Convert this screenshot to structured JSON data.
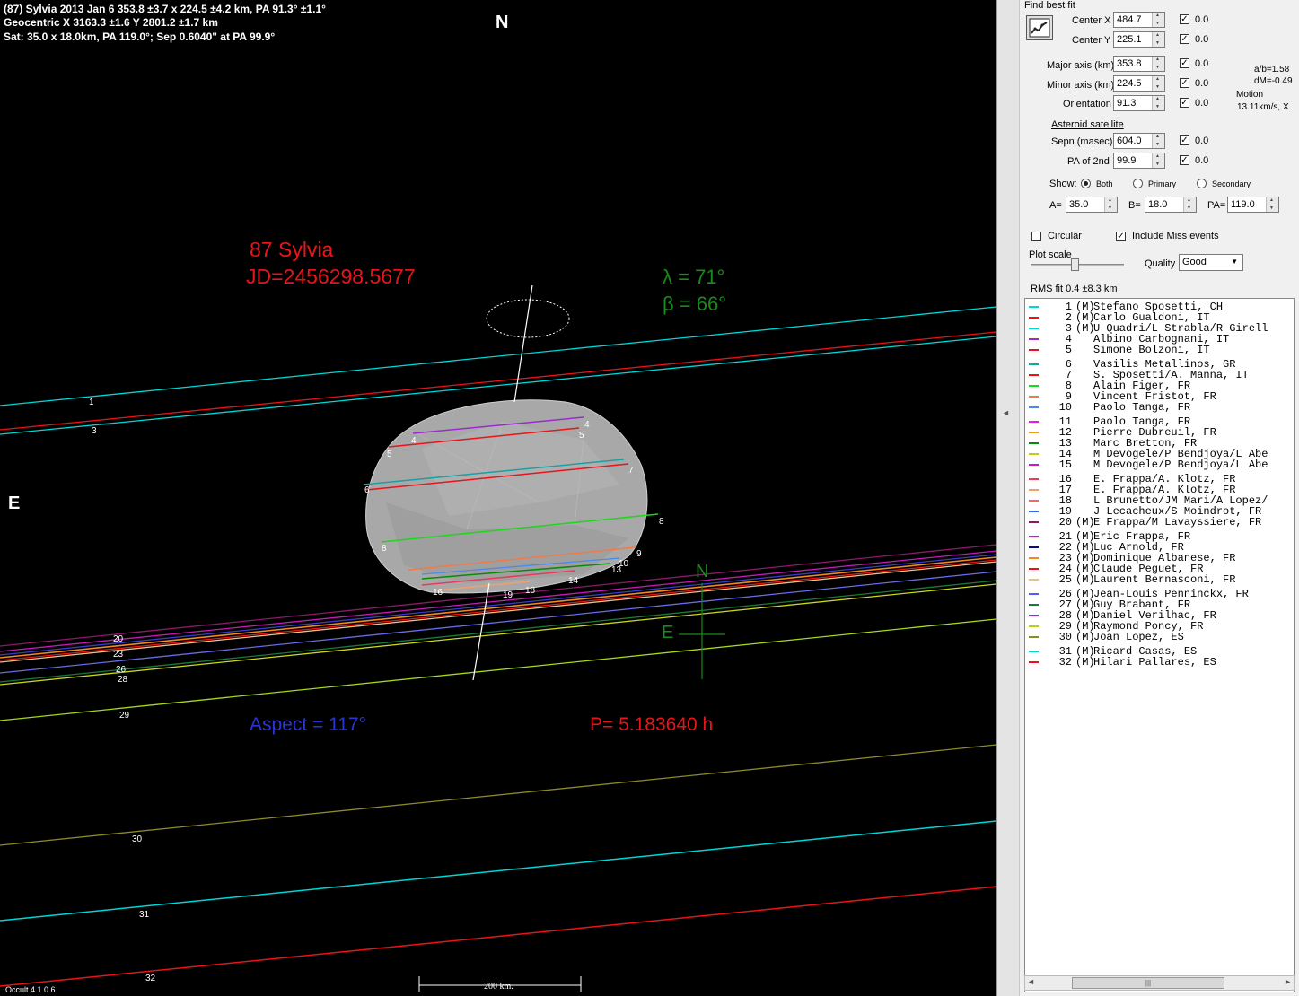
{
  "header": {
    "line1": "(87) Sylvia  2013 Jan 6   353.8 ±3.7 x 224.5 ±4.2 km, PA 91.3° ±1.1°",
    "line2": "Geocentric  X  3163.3 ±1.6  Y 2801.2 ±1.7 km",
    "line3": "Sat: 35.0 x 18.0km, PA 119.0°; Sep 0.6040\" at PA 99.9°"
  },
  "plot": {
    "north": "N",
    "east": "E",
    "asteroid_name": "87 Sylvia",
    "jd": "JD=2456298.5677",
    "lambda": "λ =   71°",
    "beta": "β =   66°",
    "aspect": "Aspect = 117°",
    "period": "P= 5.183640 h",
    "scale_label": "200 km.",
    "version": "Occult 4.1.0.6",
    "compass_n": "N",
    "compass_e": "E"
  },
  "colors": {
    "background": "#000000",
    "asteroid": "#a8a8a8",
    "title_red": "#e8141a",
    "green": "#1a8a1a",
    "aspect_blue": "#2a35d8"
  },
  "panel": {
    "find_best_fit": "Find best fit",
    "fit_icon": "fit-chart-icon",
    "center_x_label": "Center X",
    "center_x": "484.7",
    "center_x_sd": "0.0",
    "center_y_label": "Center Y",
    "center_y": "225.1",
    "center_y_sd": "0.0",
    "major_label": "Major axis (km)",
    "major": "353.8",
    "major_sd": "0.0",
    "minor_label": "Minor axis (km)",
    "minor": "224.5",
    "minor_sd": "0.0",
    "orient_label": "Orientation",
    "orient": "91.3",
    "orient_sd": "0.0",
    "ab_ratio": "a/b=1.58",
    "dm": "dM=-0.49",
    "motion_label": "Motion",
    "motion_value": "13.11km/s, X",
    "sat_heading": "Asteroid satellite",
    "sepn_label": "Sepn (masec)",
    "sepn": "604.0",
    "sepn_sd": "0.0",
    "pa2_label": "PA of 2nd",
    "pa2": "99.9",
    "pa2_sd": "0.0",
    "show_label": "Show:",
    "show_both": "Both",
    "show_primary": "Primary",
    "show_secondary": "Secondary",
    "a_label": "A=",
    "a_val": "35.0",
    "b_label": "B=",
    "b_val": "18.0",
    "pa_label": "PA=",
    "pa_val": "119.0",
    "circular": "Circular",
    "include_miss": "Include Miss events",
    "plot_scale": "Plot scale",
    "quality_label": "Quality",
    "quality_value": "Good",
    "rms": "RMS fit 0.4 ±8.3 km",
    "scroll_left": "◄",
    "scroll_right": "►",
    "scroll_thumb": "|||",
    "collapse_arrow": "◄"
  },
  "observers": [
    {
      "num": "1",
      "m": "(M)",
      "name": "Stefano Sposetti, CH",
      "color": "#00d6d6"
    },
    {
      "num": "2",
      "m": "(M)",
      "name": "Carlo Gualdoni, IT",
      "color": "#e8141a"
    },
    {
      "num": "3",
      "m": "(M)",
      "name": "U Quadri/L Strabla/R Girell",
      "color": "#00d6d6"
    },
    {
      "num": "4",
      "m": "",
      "name": "Albino Carbognani, IT",
      "color": "#9a2ad0"
    },
    {
      "num": "5",
      "m": "",
      "name": "Simone Bolzoni, IT",
      "color": "#e8141a"
    },
    {
      "num": "6",
      "m": "",
      "name": "Vasilis Metallinos, GR",
      "color": "#1aa0a0"
    },
    {
      "num": "7",
      "m": "",
      "name": "S. Sposetti/A. Manna, IT",
      "color": "#e8141a"
    },
    {
      "num": "8",
      "m": "",
      "name": "Alain Figer, FR",
      "color": "#1ad81a"
    },
    {
      "num": "9",
      "m": "",
      "name": "Vincent Fristot, FR",
      "color": "#f07a4a"
    },
    {
      "num": "10",
      "m": "",
      "name": "Paolo Tanga, FR",
      "color": "#4a8ae8"
    },
    {
      "num": "11",
      "m": "",
      "name": "Paolo Tanga, FR",
      "color": "#e81ad8"
    },
    {
      "num": "12",
      "m": "",
      "name": "Pierre Dubreuil, FR",
      "color": "#e8a01a"
    },
    {
      "num": "13",
      "m": "",
      "name": "Marc Bretton, FR",
      "color": "#0a8a0a"
    },
    {
      "num": "14",
      "m": "",
      "name": "M Devogele/P Bendjoya/L Abe",
      "color": "#c8c81a"
    },
    {
      "num": "15",
      "m": "",
      "name": "M Devogele/P Bendjoya/L Abe",
      "color": "#c81ab8"
    },
    {
      "num": "16",
      "m": "",
      "name": "E. Frappa/A. Klotz, FR",
      "color": "#e83a5a"
    },
    {
      "num": "17",
      "m": "",
      "name": "E. Frappa/A. Klotz, FR",
      "color": "#f0a070"
    },
    {
      "num": "18",
      "m": "",
      "name": "L Brunetto/JM Mari/A Lopez/",
      "color": "#e86a6a"
    },
    {
      "num": "19",
      "m": "",
      "name": "J Lecacheux/S Moindrot, FR",
      "color": "#2a6ae8"
    },
    {
      "num": "20",
      "m": "(M)",
      "name": "E Frappa/M Lavayssiere, FR",
      "color": "#8a1a6a"
    },
    {
      "num": "21",
      "m": "(M)",
      "name": "Eric Frappa, FR",
      "color": "#c81ab8"
    },
    {
      "num": "22",
      "m": "(M)",
      "name": "Luc Arnold, FR",
      "color": "#0a0a8a"
    },
    {
      "num": "23",
      "m": "(M)",
      "name": "Dominique Albanese, FR",
      "color": "#f08a1a"
    },
    {
      "num": "24",
      "m": "(M)",
      "name": "Claude Peguet, FR",
      "color": "#e8141a"
    },
    {
      "num": "25",
      "m": "(M)",
      "name": "Laurent Bernasconi, FR",
      "color": "#f0c080"
    },
    {
      "num": "26",
      "m": "(M)",
      "name": "Jean-Louis Penninckx, FR",
      "color": "#5a5ae8"
    },
    {
      "num": "27",
      "m": "(M)",
      "name": "Guy Brabant, FR",
      "color": "#1a7a3a"
    },
    {
      "num": "28",
      "m": "(M)",
      "name": "Daniel Verilhac, FR",
      "color": "#9a2ad0"
    },
    {
      "num": "29",
      "m": "(M)",
      "name": "Raymond Poncy, FR",
      "color": "#a8d81a"
    },
    {
      "num": "30",
      "m": "(M)",
      "name": "Joan Lopez, ES",
      "color": "#8a8a2a"
    },
    {
      "num": "31",
      "m": "(M)",
      "name": "Ricard Casas, ES",
      "color": "#00d6d6"
    },
    {
      "num": "32",
      "m": "(M)",
      "name": "Hilari Pallares, ES",
      "color": "#e8141a"
    }
  ]
}
